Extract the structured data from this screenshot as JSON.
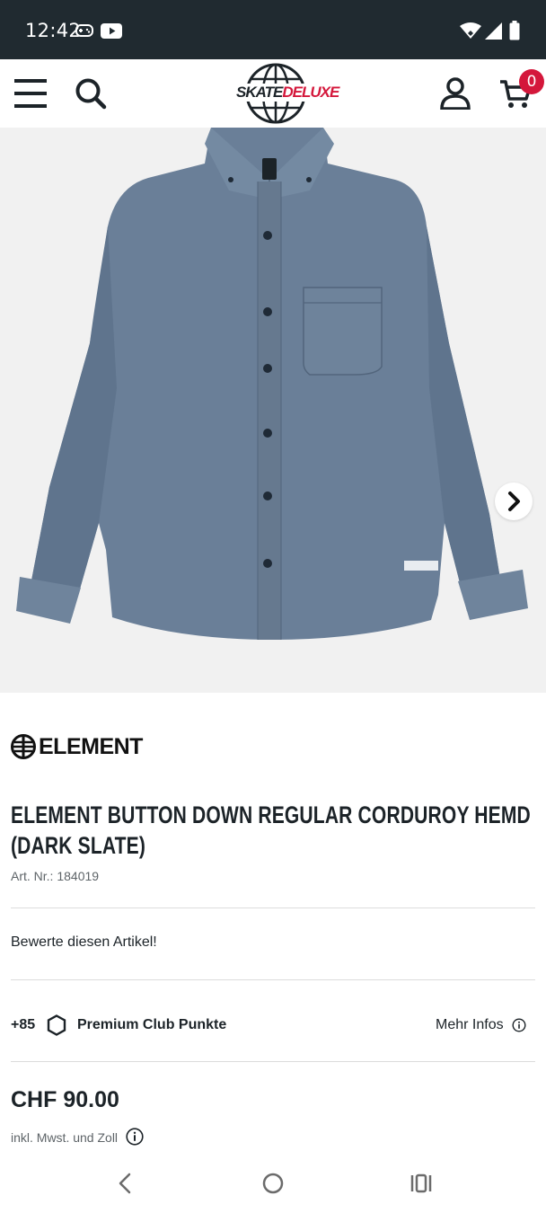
{
  "status_bar": {
    "time": "12:42",
    "icons": [
      "gamepad-icon",
      "youtube-icon",
      "wifi-icon",
      "signal-icon",
      "battery-icon"
    ]
  },
  "header": {
    "logo_text_skate": "SKATE",
    "logo_text_deluxe": "DELUXE",
    "cart_count": "0",
    "icons": [
      "menu-icon",
      "search-icon",
      "account-icon",
      "cart-icon"
    ]
  },
  "gallery": {
    "image": "product-shirt-image",
    "next_icon": "chevron-right-icon"
  },
  "product": {
    "brand": "ELEMENT",
    "title": "ELEMENT BUTTON DOWN REGULAR CORDUROY HEMD (DARK SLATE)",
    "art_nr": "Art. Nr.: 184019",
    "rate_label": "Bewerte diesen Artikel!",
    "points_count": "+85",
    "points_label": "Premium Club Punkte",
    "more_info": "Mehr Infos",
    "price": "CHF 90.00",
    "tax_note": "inkl. Mwst. und Zoll"
  },
  "colors": {
    "status_bar": "#202a30",
    "accent": "#d4173b",
    "text": "#1c2328",
    "shirt": "#6a7f98"
  }
}
